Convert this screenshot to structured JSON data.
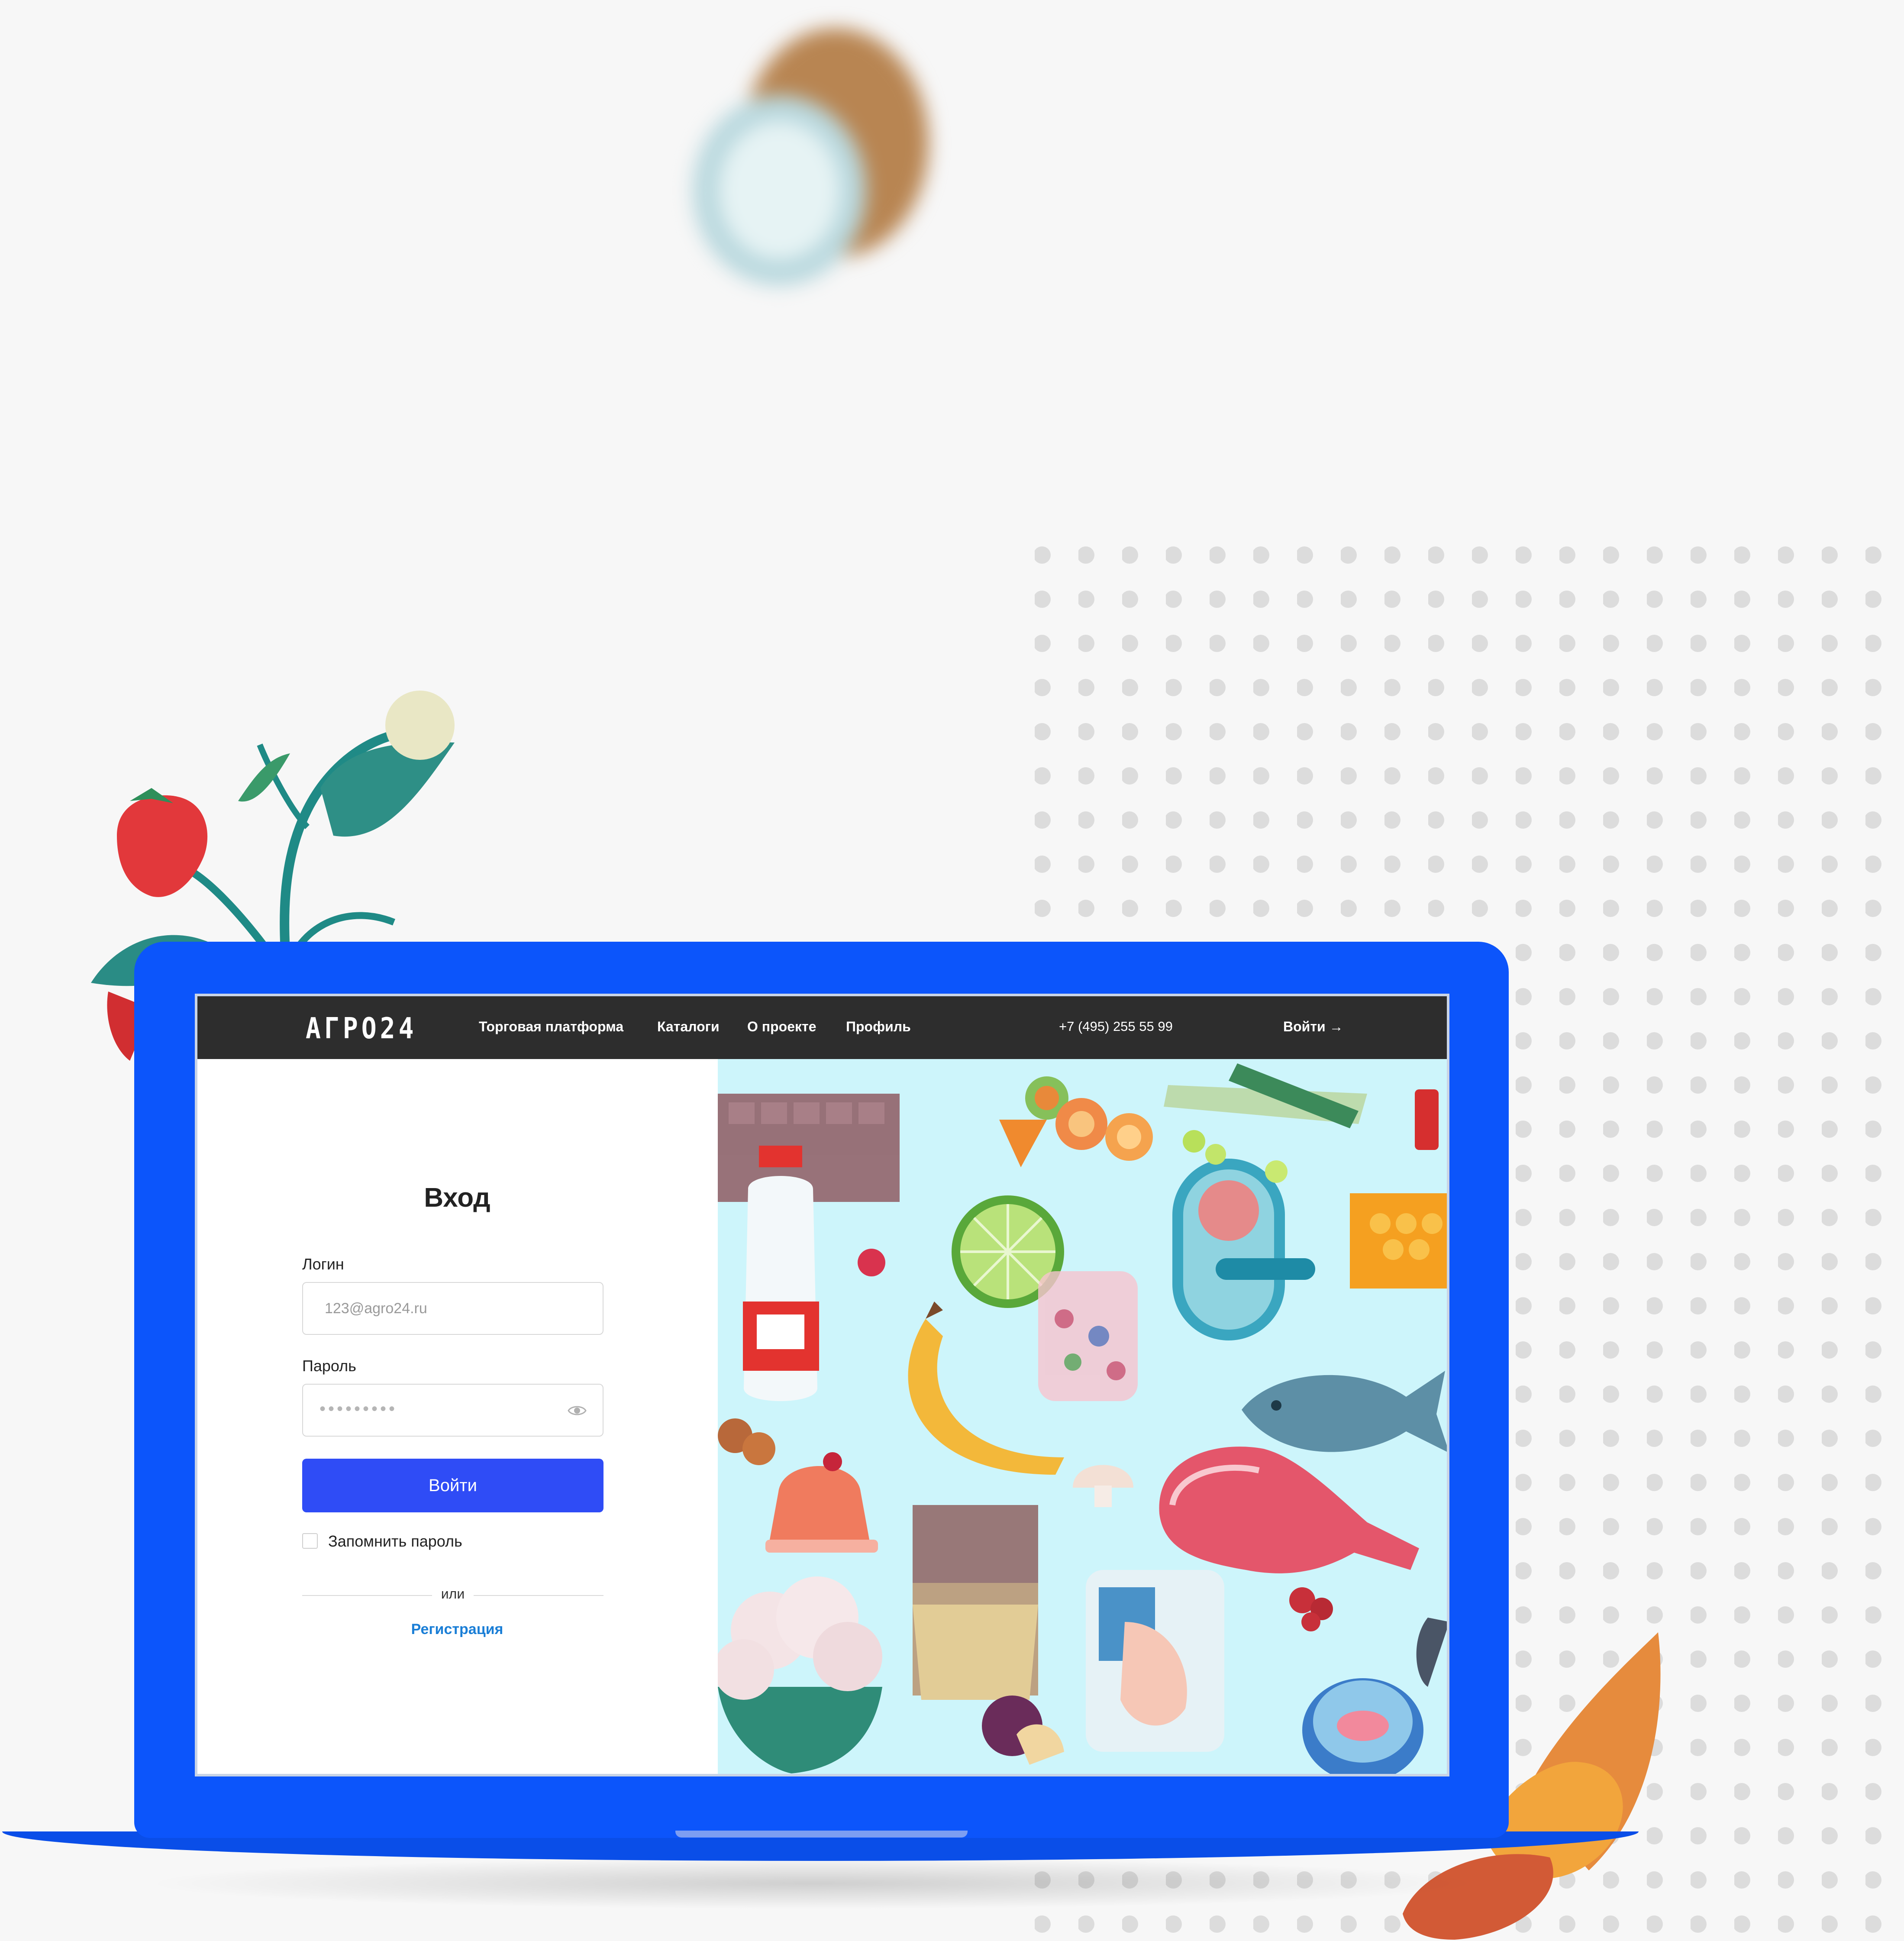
{
  "header": {
    "logo": "АГРО24",
    "nav": [
      "Торговая платформа",
      "Каталоги",
      "О проекте",
      "Профиль"
    ],
    "phone": "+7 (495) 255 55 99",
    "signin_link": "Войти →"
  },
  "login": {
    "title": "Вход",
    "login_label": "Логин",
    "login_placeholder": "123@agro24.ru",
    "password_label": "Пароль",
    "password_mask": "•••••••••",
    "submit_label": "Войти",
    "remember_label": "Запомнить пароль",
    "divider_text": "или",
    "register_link": "Регистрация"
  },
  "colors": {
    "laptop_blue": "#0c55fb",
    "header_bg": "#2d2d2d",
    "button_blue": "#2f4cf6",
    "link_blue": "#1a7ed6",
    "food_bg": "#cdf5fb"
  },
  "icons": [
    "eye-icon",
    "arrow-right-icon",
    "strawberry-plant",
    "almond",
    "grocery-illustration"
  ]
}
